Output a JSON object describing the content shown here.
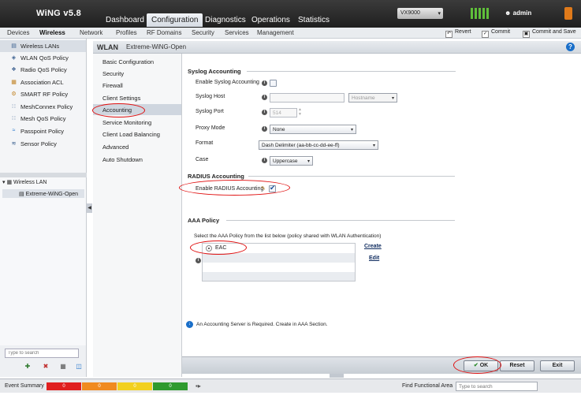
{
  "app": {
    "logo": "WiNG v5.8"
  },
  "main_tabs": [
    {
      "label": "Dashboard",
      "active": false
    },
    {
      "label": "Configuration",
      "active": true
    },
    {
      "label": "Diagnostics",
      "active": false
    },
    {
      "label": "Operations",
      "active": false
    },
    {
      "label": "Statistics",
      "active": false
    }
  ],
  "device_selector": {
    "value": "VX9000"
  },
  "user": {
    "name": "admin"
  },
  "sub_tabs": [
    {
      "label": "Devices",
      "active": false
    },
    {
      "label": "Wireless",
      "active": true
    },
    {
      "label": "Network",
      "active": false
    },
    {
      "label": "Profiles",
      "active": false
    },
    {
      "label": "RF Domains",
      "active": false
    },
    {
      "label": "Security",
      "active": false
    },
    {
      "label": "Services",
      "active": false
    },
    {
      "label": "Management",
      "active": false
    }
  ],
  "actions": {
    "revert": "Revert",
    "commit": "Commit",
    "commit_save": "Commit and Save"
  },
  "left_nav": [
    {
      "label": "Wireless LANs",
      "icon": "wireless-lans-icon",
      "selected": true
    },
    {
      "label": "WLAN QoS Policy",
      "icon": "qos-icon"
    },
    {
      "label": "Radio QoS Policy",
      "icon": "radio-qos-icon"
    },
    {
      "label": "Association ACL",
      "icon": "acl-icon"
    },
    {
      "label": "SMART RF Policy",
      "icon": "smart-rf-icon"
    },
    {
      "label": "MeshConnex Policy",
      "icon": "mesh-icon"
    },
    {
      "label": "Mesh QoS Policy",
      "icon": "mesh-qos-icon"
    },
    {
      "label": "Passpoint Policy",
      "icon": "passpoint-icon"
    },
    {
      "label": "Sensor Policy",
      "icon": "sensor-icon"
    }
  ],
  "tree": {
    "root": "Wireless LAN",
    "child": "Extreme-WiNG-Open"
  },
  "left_search": {
    "placeholder": "Type to search"
  },
  "wlan_header": {
    "title": "WLAN",
    "name": "Extreme-WiNG-Open"
  },
  "section_menu": [
    {
      "label": "Basic Configuration"
    },
    {
      "label": "Security"
    },
    {
      "label": "Firewall"
    },
    {
      "label": "Client Settings"
    },
    {
      "label": "Accounting",
      "selected": true
    },
    {
      "label": "Service Monitoring"
    },
    {
      "label": "Client Load Balancing"
    },
    {
      "label": "Advanced"
    },
    {
      "label": "Auto Shutdown"
    }
  ],
  "syslog": {
    "heading": "Syslog Accounting",
    "enable_label": "Enable Syslog Accounting",
    "host_label": "Syslog Host",
    "host_value": "",
    "host_type": "Hostname",
    "port_label": "Syslog Port",
    "port_value": "514",
    "proxy_label": "Proxy Mode",
    "proxy_value": "None",
    "format_label": "Format",
    "format_value": "Dash Delimiter (aa-bb-cc-dd-ee-ff)",
    "case_label": "Case",
    "case_value": "Uppercase"
  },
  "radius": {
    "heading": "RADIUS Accounting",
    "enable_label": "Enable RADIUS Accounting",
    "enabled": true
  },
  "aaa": {
    "heading": "AAA Policy",
    "instruction": "Select the AAA Policy from the list below (policy shared with WLAN Authentication)",
    "policies": [
      "EAC"
    ],
    "create_label": "Create",
    "edit_label": "Edit",
    "notice": "An Accounting Server is Required. Create in AAA Section."
  },
  "footer": {
    "ok": "OK",
    "reset": "Reset",
    "exit": "Exit"
  },
  "event_summary": {
    "label": "Event Summary",
    "segments": [
      {
        "value": "0",
        "color": "#e02020"
      },
      {
        "value": "0",
        "color": "#f08a20"
      },
      {
        "value": "0",
        "color": "#f2d020"
      },
      {
        "value": "0",
        "color": "#2f9a2f"
      }
    ]
  },
  "find_area": {
    "label": "Find Functional Area",
    "placeholder": "Type to search"
  }
}
